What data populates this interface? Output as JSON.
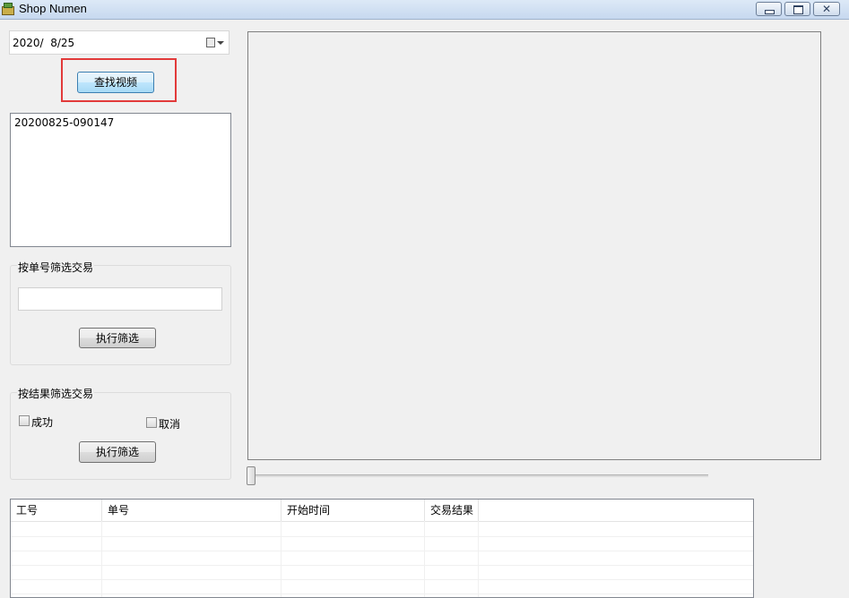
{
  "window": {
    "title": "Shop Numen",
    "app_icon": "shop-app-icon",
    "controls": {
      "minimize_icon": "minimize-icon",
      "maximize_icon": "maximize-icon",
      "close_icon": "close-icon"
    }
  },
  "date_picker": {
    "value": "2020/  8/25",
    "icon": "calendar-icon"
  },
  "find_video_button": "查找视频",
  "video_list": {
    "items": [
      "20200825-090147"
    ]
  },
  "filter_by_order": {
    "title": "按单号筛选交易",
    "input_value": "",
    "run_button": "执行筛选"
  },
  "filter_by_result": {
    "title": "按结果筛选交易",
    "success_label": "成功",
    "success_checked": false,
    "cancel_label": "取消",
    "cancel_checked": false,
    "run_button": "执行筛选"
  },
  "playback": {
    "position_fraction": 0
  },
  "transactions_table": {
    "columns": [
      "工号",
      "单号",
      "开始时间",
      "交易结果",
      ""
    ],
    "rows": []
  },
  "colors": {
    "highlight": "#e23a3a",
    "background": "#f0f0f0"
  }
}
